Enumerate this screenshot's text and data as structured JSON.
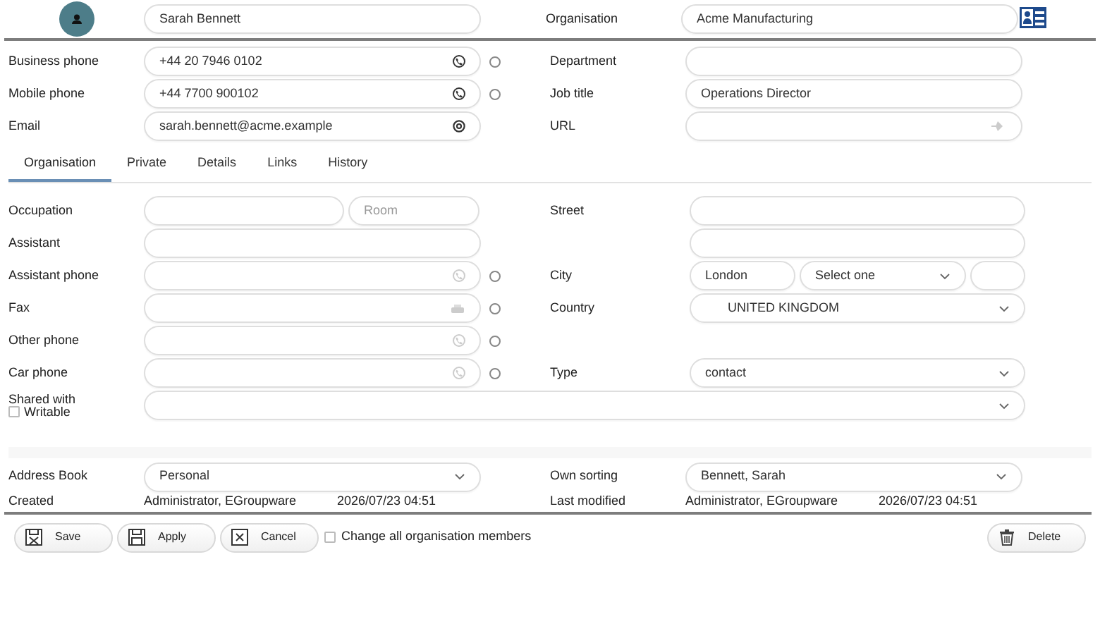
{
  "header": {
    "name": "Sarah Bennett",
    "organisation_label": "Organisation",
    "organisation": "Acme Manufacturing"
  },
  "contact_rows": [
    {
      "left": {
        "label": "Business phone",
        "value": "+44 20 7946 0102",
        "kind": "phone",
        "selected": false
      },
      "right": {
        "label": "Department",
        "kind": "text"
      }
    },
    {
      "left": {
        "label": "Mobile phone",
        "value": "+44 7700 900102",
        "kind": "phone",
        "selected": false
      },
      "right": {
        "label": "Job title",
        "value": "Operations Director",
        "kind": "text"
      }
    },
    {
      "left": {
        "label": "Email",
        "value": "sarah.bennett@acme.example",
        "kind": "email"
      },
      "right": {
        "label": "URL",
        "kind": "url"
      }
    }
  ],
  "tabs": [
    {
      "label": "Organisation",
      "selected": true
    },
    {
      "label": "Private",
      "selected": false
    },
    {
      "label": "Details",
      "selected": false
    },
    {
      "label": "Links",
      "selected": false
    },
    {
      "label": "History",
      "selected": false
    }
  ],
  "tab_rows": [
    {
      "left": {
        "label": "Occupation",
        "fields": [
          {
            "kind": "text"
          },
          {
            "kind": "text",
            "placeholder": "Room"
          }
        ]
      },
      "right": {
        "label": "Street",
        "fields": [
          {
            "kind": "text"
          }
        ]
      }
    },
    {
      "left": {
        "label": "Assistant",
        "fields": [
          {
            "kind": "text"
          }
        ]
      },
      "right": {
        "fields": [
          {
            "kind": "text"
          }
        ]
      }
    },
    {
      "left": {
        "label": "Assistant phone",
        "fields": [
          {
            "kind": "phone",
            "selected": false
          }
        ]
      },
      "right": {
        "label": "City",
        "fields": [
          {
            "kind": "text",
            "value": "London"
          },
          {
            "kind": "select",
            "value": "Select one"
          },
          {
            "kind": "text"
          }
        ]
      }
    },
    {
      "left": {
        "label": "Fax",
        "fields": [
          {
            "kind": "fax",
            "selected": false
          }
        ]
      },
      "right": {
        "label": "Country",
        "fields": [
          {
            "kind": "country",
            "value": "UNITED KINGDOM"
          }
        ]
      }
    },
    {
      "left": {
        "label": "Other phone",
        "fields": [
          {
            "kind": "phone",
            "selected": false
          }
        ]
      }
    },
    {
      "left": {
        "label": "Car phone",
        "fields": [
          {
            "kind": "phone",
            "selected": false
          }
        ]
      },
      "right": {
        "label": "Type",
        "fields": [
          {
            "kind": "select",
            "value": "contact"
          }
        ]
      }
    }
  ],
  "shared": {
    "label": "Shared with",
    "writable": {
      "label": "Writable",
      "checked": false
    }
  },
  "footer_rows": [
    {
      "left": {
        "label": "Address Book",
        "value": "Personal"
      },
      "right": {
        "label": "Own sorting",
        "value": "Bennett, Sarah"
      }
    }
  ],
  "meta": {
    "created": {
      "label": "Created",
      "by": "Administrator, EGroupware",
      "date": "2026/07/23 04:51"
    },
    "modified": {
      "label": "Last modified",
      "by": "Administrator, EGroupware",
      "date": "2026/07/23 04:51"
    }
  },
  "buttons": [
    {
      "label": "Save",
      "kind": "save"
    },
    {
      "label": "Apply",
      "kind": "apply"
    },
    {
      "label": "Cancel",
      "kind": "cancel"
    }
  ],
  "change_all": {
    "label": "Change all organisation members",
    "checked": false
  },
  "delete_button": {
    "label": "Delete",
    "kind": "delete"
  }
}
